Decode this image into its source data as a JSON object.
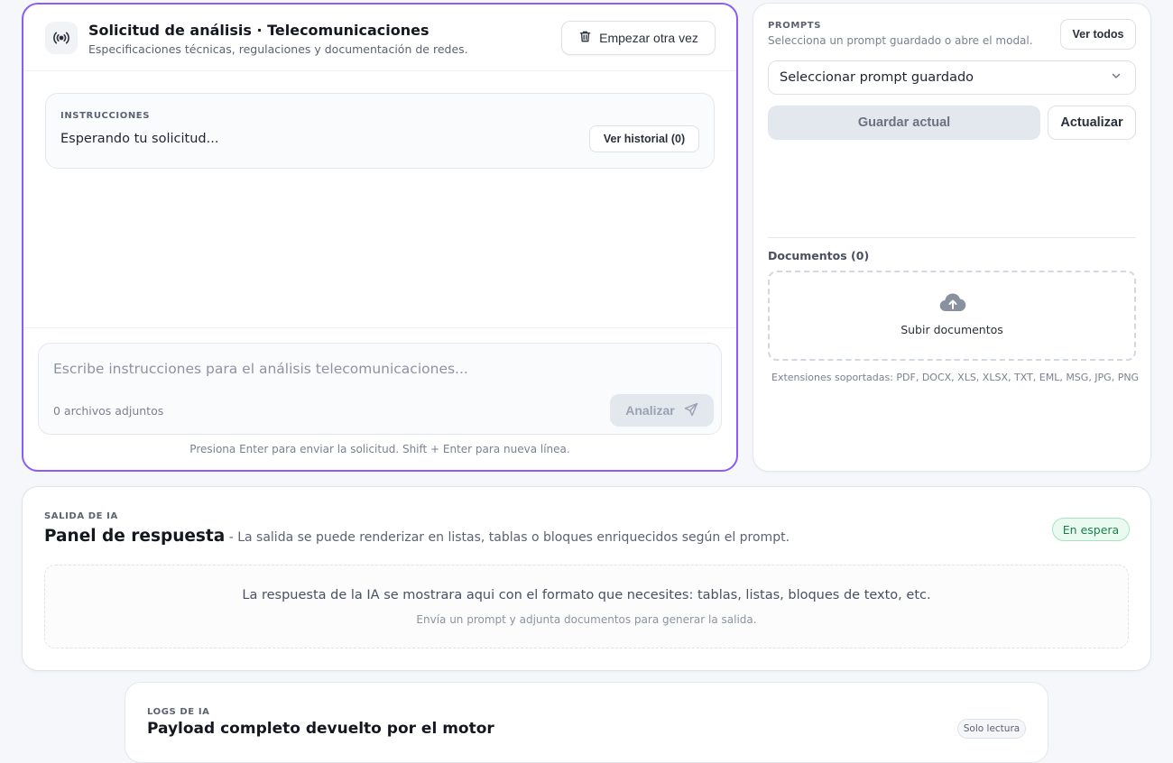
{
  "request": {
    "title": "Solicitud de análisis · Telecomunicaciones",
    "subtitle": "Especificaciones técnicas, regulaciones y documentación de redes.",
    "icon": "broadcast-icon",
    "restart_label": "Empezar otra vez",
    "instructions": {
      "label": "INSTRUCCIONES",
      "text": "Esperando tu solicitud...",
      "history_label": "Ver historial (0)"
    },
    "composer": {
      "placeholder": "Escribe instrucciones para el análisis telecomunicaciones...",
      "attachments": "0 archivos adjuntos",
      "analyze_label": "Analizar"
    },
    "hint": "Presiona Enter para enviar la solicitud. Shift + Enter para nueva línea."
  },
  "prompts": {
    "label": "PROMPTS",
    "subtitle": "Selecciona un prompt guardado o abre el modal.",
    "view_all_label": "Ver todos",
    "select_value": "Seleccionar prompt guardado",
    "save_label": "Guardar actual",
    "update_label": "Actualizar",
    "documents_label": "Documentos (0)",
    "upload_label": "Subir documentos",
    "extensions": "Extensiones soportadas: PDF, DOCX, XLS, XLSX, TXT, EML, MSG, JPG, PNG"
  },
  "response": {
    "label": "SALIDA DE IA",
    "title": "Panel de respuesta",
    "description": " - La salida se puede renderizar en listas, tablas o bloques enriquecidos según el prompt.",
    "status": "En espera",
    "empty_main": "La respuesta de la IA se mostrara aqui con el formato que necesites: tablas, listas, bloques de texto, etc.",
    "empty_sub": "Envía un prompt y adjunta documentos para generar la salida."
  },
  "logs": {
    "label": "LOGS DE IA",
    "title": "Payload completo devuelto por el motor",
    "badge": "Solo lectura"
  },
  "colors": {
    "accent": "#8b5cf6",
    "status_green": "#18804a",
    "status_green_bg": "#eafaf1"
  }
}
